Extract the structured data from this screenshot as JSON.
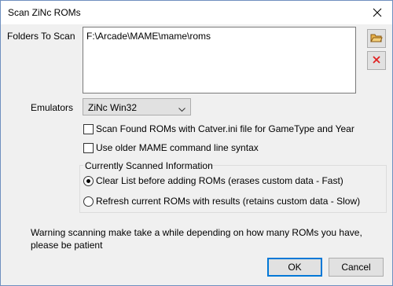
{
  "window": {
    "title": "Scan ZiNc ROMs",
    "close_icon": "close-icon"
  },
  "folders": {
    "label": "Folders To Scan",
    "items": [
      "F:\\Arcade\\MAME\\mame\\roms"
    ],
    "add_icon": "folder-add-icon",
    "remove_icon": "remove-x-icon",
    "remove_color": "#e02020"
  },
  "emulators": {
    "label": "Emulators",
    "selected": "ZiNc Win32"
  },
  "options": {
    "catver": {
      "label": "Scan Found ROMs with Catver.ini file for GameType and Year",
      "checked": false
    },
    "older_mame": {
      "label": "Use older MAME command line syntax",
      "checked": false
    }
  },
  "scanned": {
    "group_label": "Currently Scanned Information",
    "clear_list": {
      "label": "Clear List before adding ROMs (erases custom data - Fast)",
      "selected": true
    },
    "refresh": {
      "label": "Refresh current ROMs with results (retains custom data - Slow)",
      "selected": false
    }
  },
  "warning": "Warning scanning make take a while depending on how many ROMs you have, please be patient",
  "buttons": {
    "ok": "OK",
    "cancel": "Cancel"
  }
}
